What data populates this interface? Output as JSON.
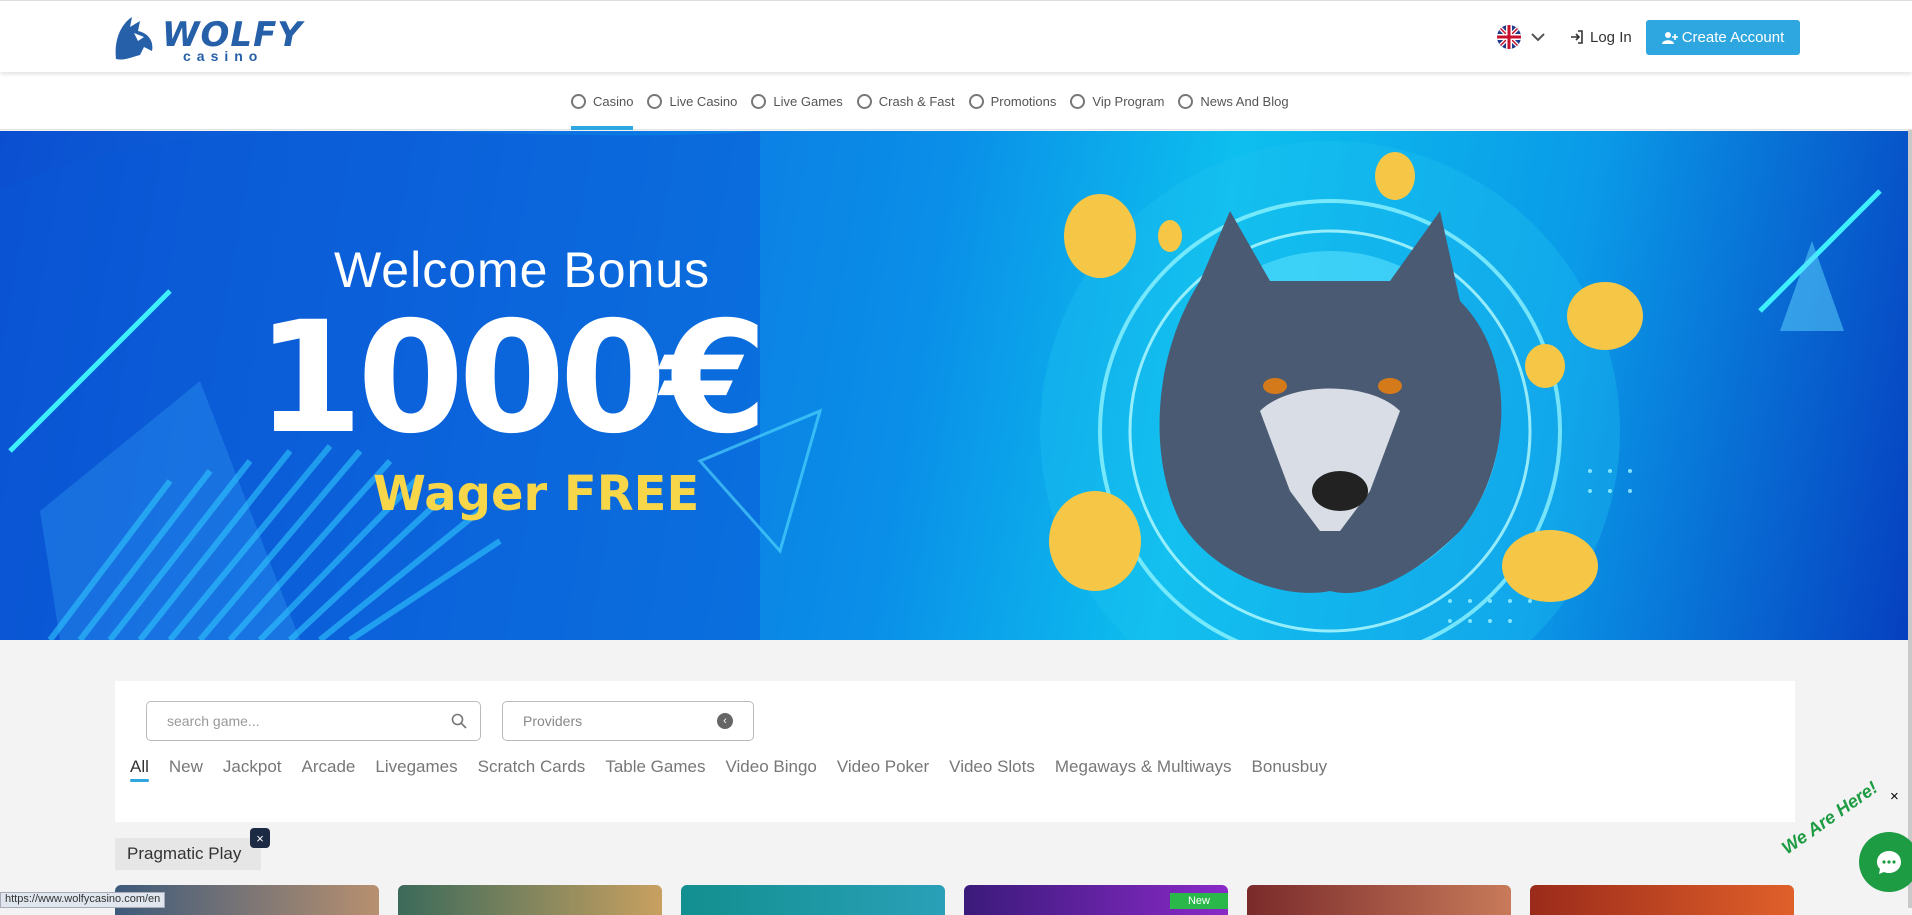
{
  "header": {
    "logo_text": "WOLFY",
    "logo_sub": "casino",
    "login_label": "Log In",
    "create_account_label": "Create Account"
  },
  "nav": {
    "items": [
      {
        "label": "Casino",
        "icon": "casino-chip-icon"
      },
      {
        "label": "Live Casino",
        "icon": "live-casino-icon"
      },
      {
        "label": "Live Games",
        "icon": "live-games-icon"
      },
      {
        "label": "Crash & Fast",
        "icon": "rocket-icon"
      },
      {
        "label": "Promotions",
        "icon": "gift-icon"
      },
      {
        "label": "Vip Program",
        "icon": "crown-icon"
      },
      {
        "label": "News And Blog",
        "icon": "news-icon"
      }
    ],
    "active": "Casino"
  },
  "hero": {
    "title": "Welcome Bonus",
    "amount": "1000€",
    "subtitle": "Wager FREE"
  },
  "filters": {
    "search_placeholder": "search game...",
    "providers_label": "Providers",
    "categories": [
      "All",
      "New",
      "Jackpot",
      "Arcade",
      "Livegames",
      "Scratch Cards",
      "Table Games",
      "Video Bingo",
      "Video Poker",
      "Video Slots",
      "Megaways & Multiways",
      "Bonusbuy"
    ],
    "active_category": "All"
  },
  "provider_tag": {
    "label": "Pragmatic Play",
    "close": "×"
  },
  "games": {
    "new_badge": "New"
  },
  "status_bar": {
    "url": "https://www.wolfycasino.com/en"
  },
  "chat": {
    "close": "×",
    "bubble_text": "We Are Here!"
  },
  "colors": {
    "accent": "#2ea6e0",
    "brand": "#2560a8",
    "wager": "#f8d64a",
    "chat": "#1e9c43"
  }
}
